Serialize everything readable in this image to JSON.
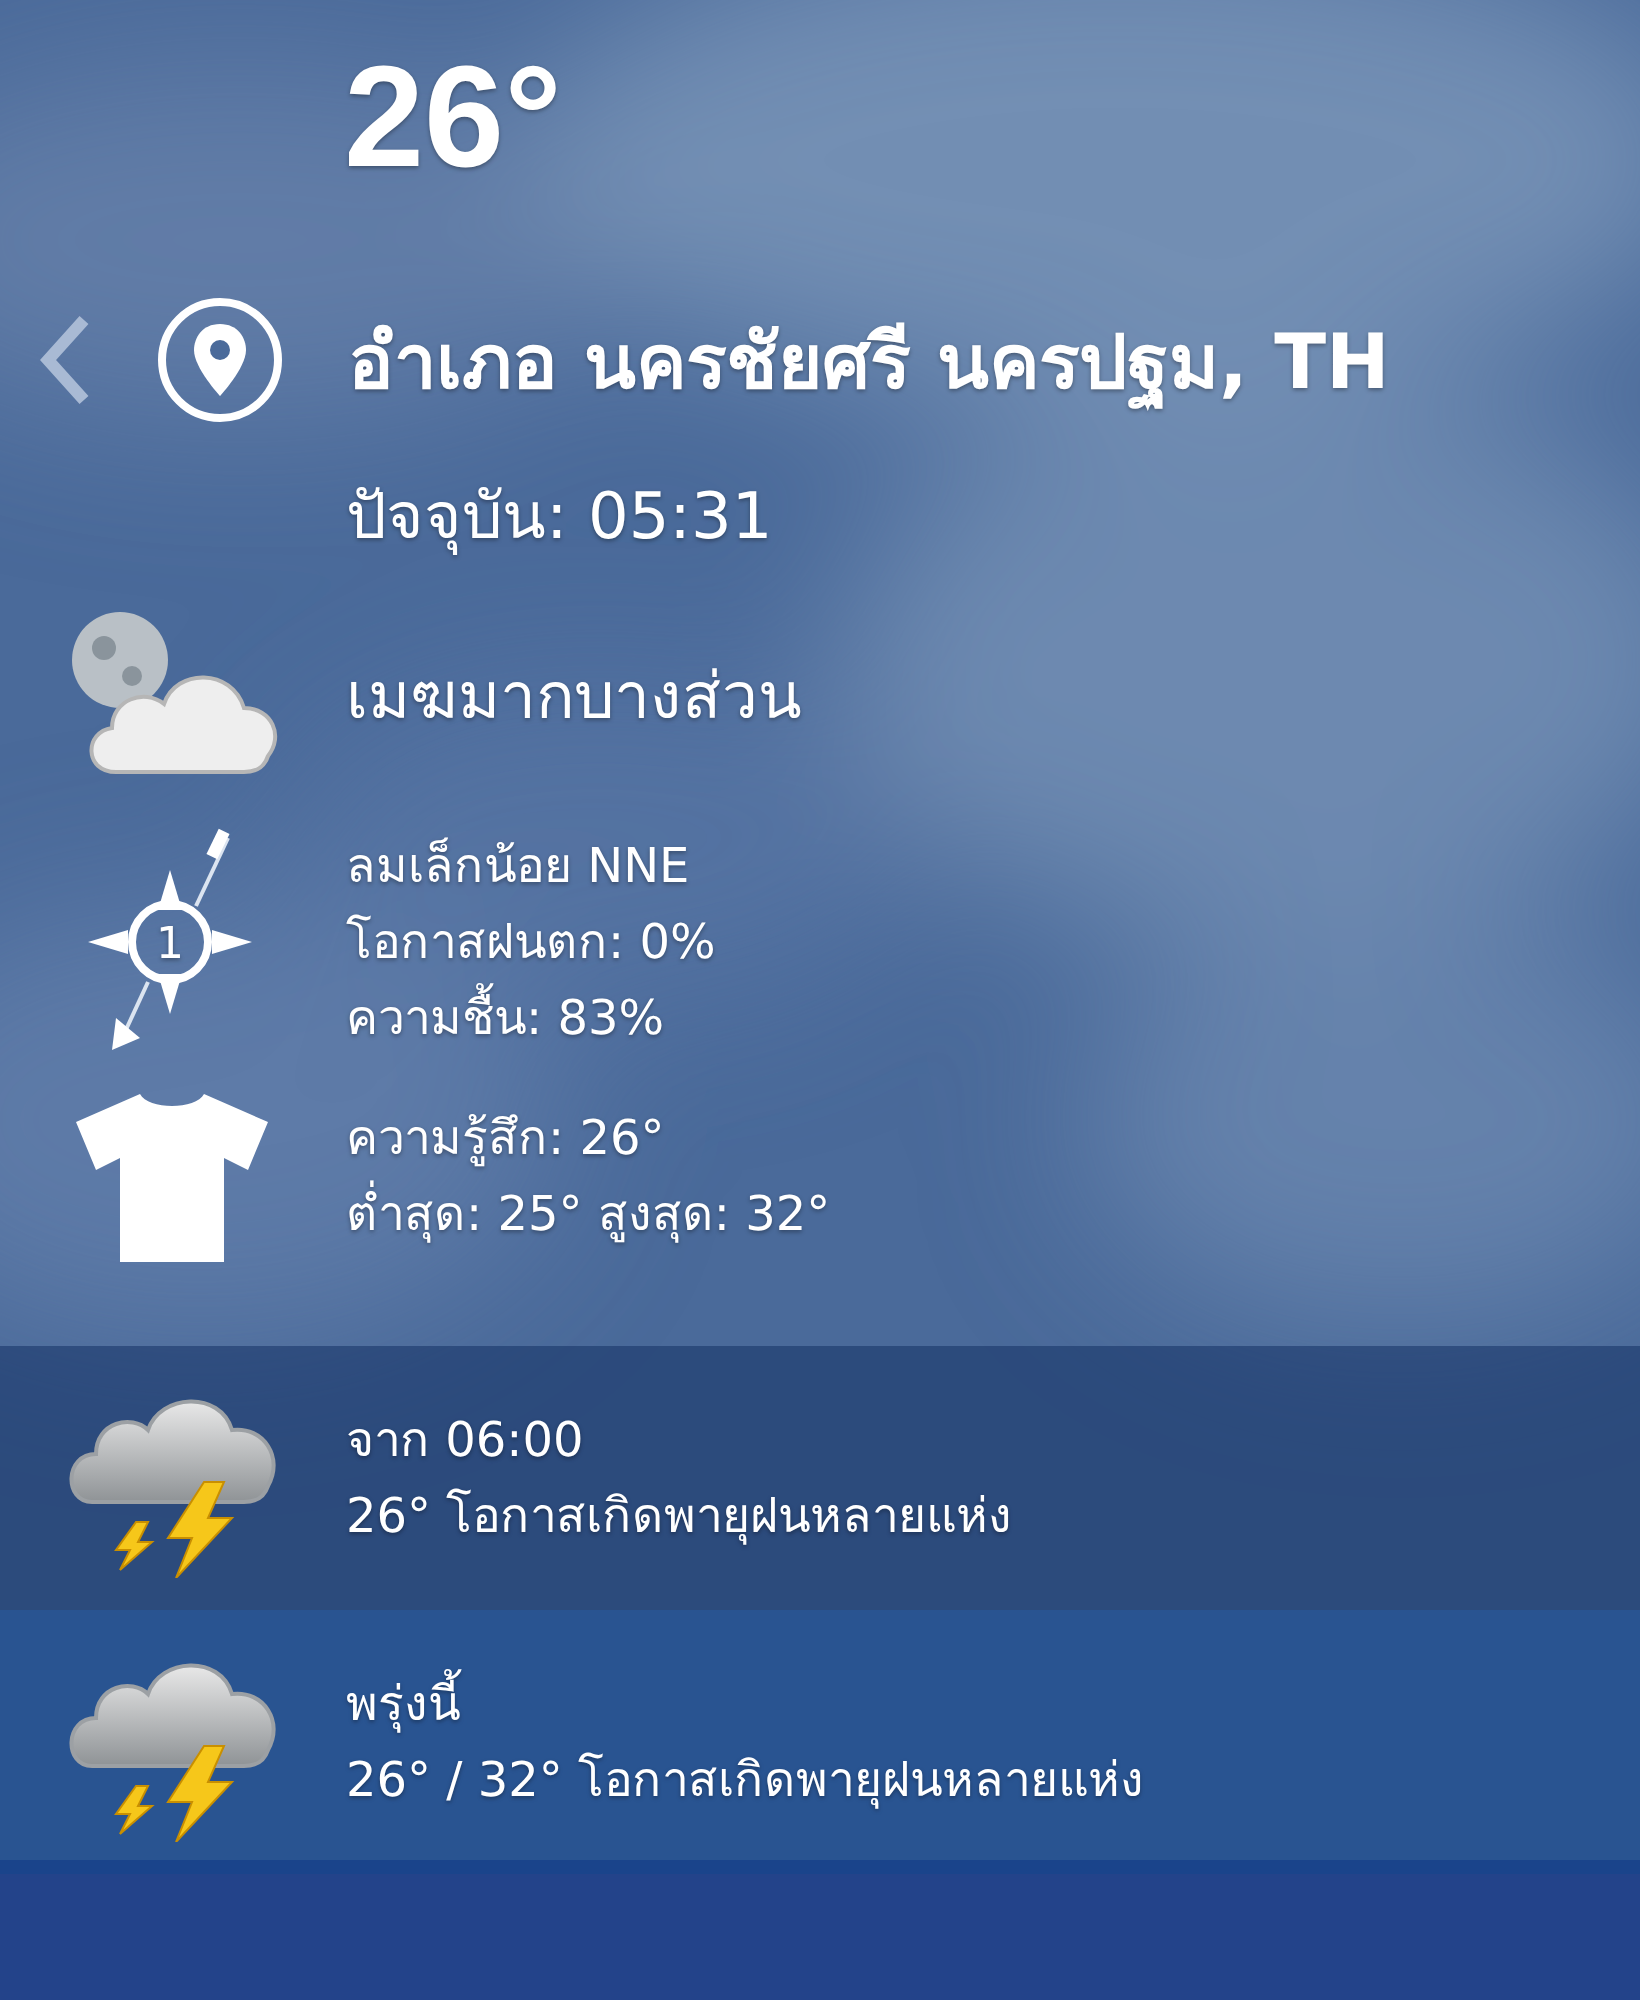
{
  "temperature": "26°",
  "location": "อำเภอ นครชัยศรี นครปฐม, TH",
  "updated": "ปัจจุบัน: 05:31",
  "condition": {
    "kind": "moon-cloud",
    "text": "เมฆมากบางส่วน"
  },
  "details": [
    {
      "kind": "wind",
      "badge": "1",
      "lines": [
        "ลมเล็กน้อย NNE",
        "โอกาสฝนตก: 0%",
        "ความชื้น: 83%"
      ]
    },
    {
      "kind": "feel",
      "lines": [
        "ความรู้สึก: 26°",
        "ต่ำสุด: 25° สูงสุด: 32°"
      ]
    }
  ],
  "forecast": [
    {
      "kind": "thunderstorm",
      "title": "จาก 06:00",
      "summary": "26° โอกาสเกิดพายุฝนหลายแห่ง"
    },
    {
      "kind": "thunderstorm",
      "title": "พรุ่งนี้",
      "summary": "26° / 32° โอกาสเกิดพายุฝนหลายแห่ง"
    }
  ]
}
